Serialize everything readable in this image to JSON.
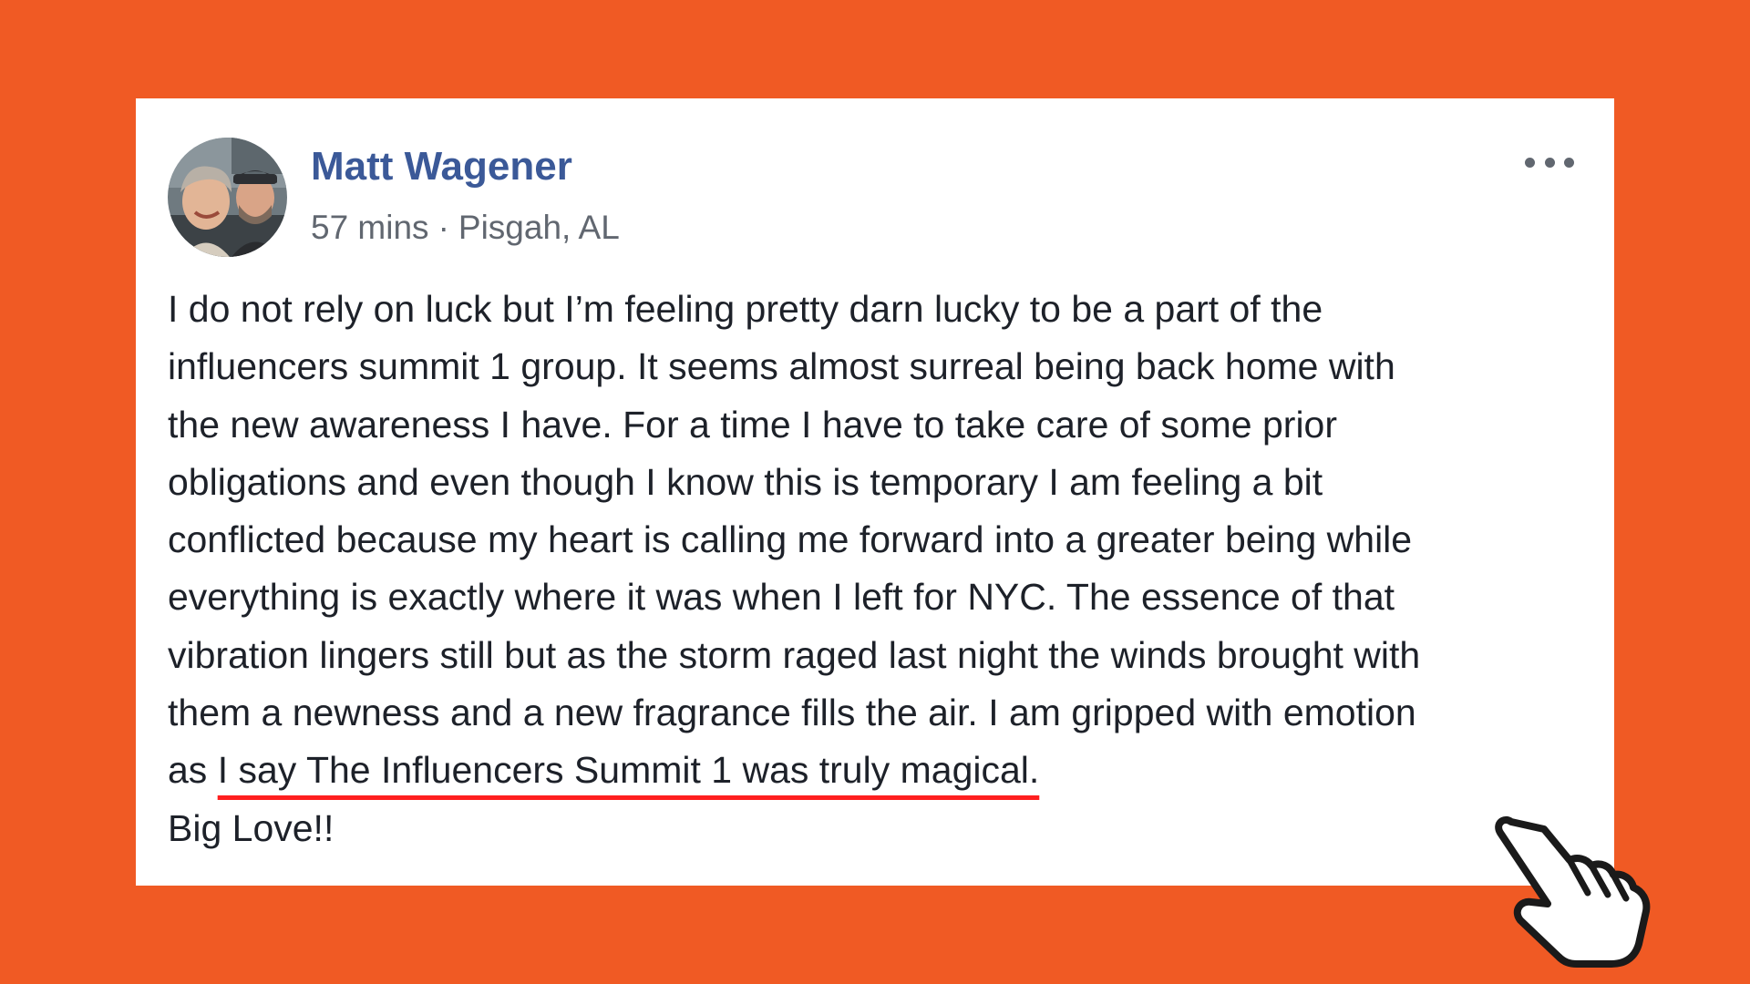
{
  "post": {
    "author": "Matt Wagener",
    "time": "57 mins",
    "separator": "·",
    "location": "Pisgah, AL",
    "body_lines": [
      "I do not rely on luck but I’m feeling pretty darn lucky to be a part of the",
      "influencers summit 1 group. It seems almost surreal being back home with",
      "the new awareness I have. For a time I have to take care of some prior",
      "obligations and even though I know this is temporary I am feeling a bit",
      "conflicted because my heart is calling me forward into a greater being while",
      "everything is exactly where it was when I left for NYC. The essence of that",
      "vibration lingers still but as the storm raged last night the winds brought with",
      "them a newness and a new fragrance fills the air. I am gripped with emotion"
    ],
    "body_line9_prefix": "as ",
    "highlighted_text": "I say The Influencers Summit 1 was truly magical.",
    "signoff": "Big Love!!"
  },
  "icons": {
    "more": "more-options-icon",
    "pointer": "pointing-hand-icon"
  },
  "colors": {
    "background": "#f05a24",
    "card": "#ffffff",
    "author_link": "#3b5998",
    "underline": "#ff1f1f"
  }
}
